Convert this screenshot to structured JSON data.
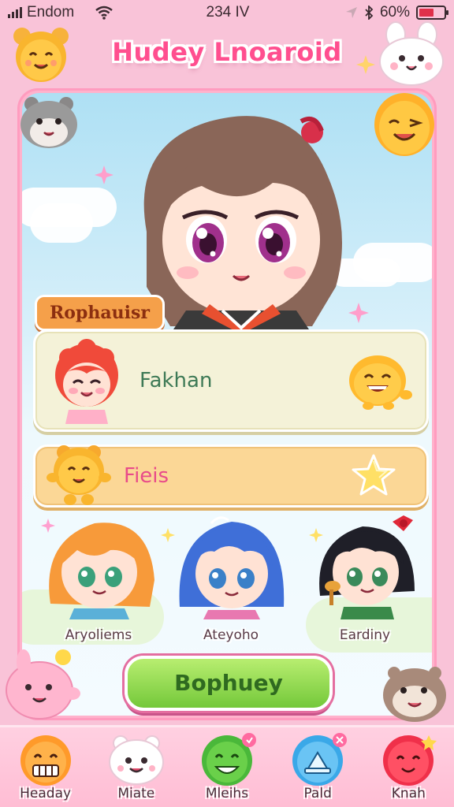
{
  "status_bar": {
    "carrier": "Endom",
    "time": "234 IV",
    "battery": "60%",
    "battery_level": 0.6
  },
  "app_title": "Hudey Lnoaroid",
  "section_label": "Rophauisr",
  "cards": [
    {
      "label": "Fakhan"
    },
    {
      "label": "Fieis"
    }
  ],
  "characters": [
    {
      "name": "Aryoliems"
    },
    {
      "name": "Ateyoho"
    },
    {
      "name": "Eardiny"
    }
  ],
  "main_button": "Bophuey",
  "bottom_nav": [
    {
      "label": "Headay"
    },
    {
      "label": "Miate"
    },
    {
      "label": "Mleihs"
    },
    {
      "label": "Pald"
    },
    {
      "label": "Knah"
    }
  ],
  "colors": {
    "background": "#f9c3d8",
    "title": "#ff4f8f",
    "accent_green": "#74c83a",
    "section_orange": "#f5a04a"
  }
}
